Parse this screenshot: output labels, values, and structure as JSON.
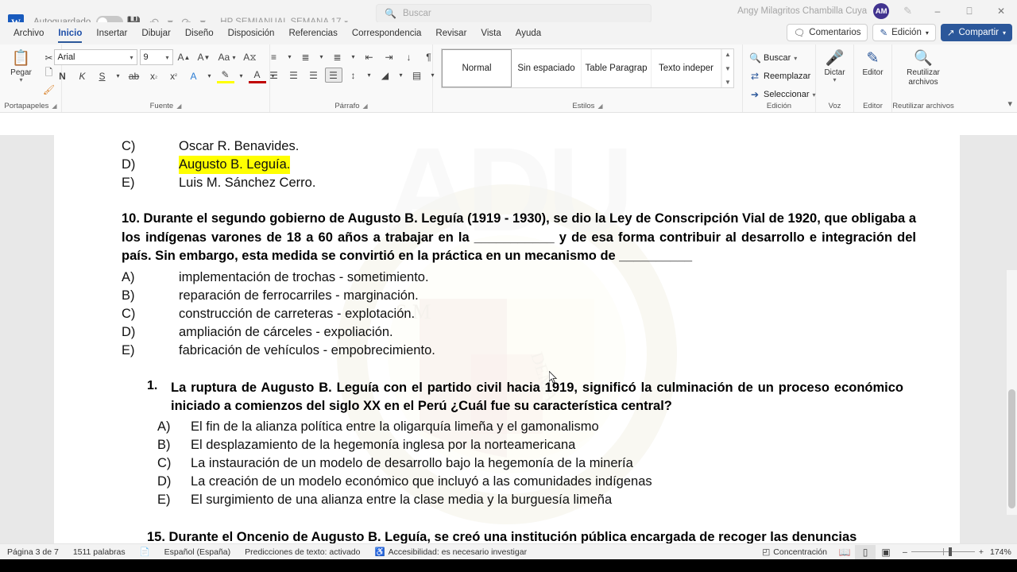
{
  "titlebar": {
    "autosave_label": "Autoguardado",
    "autosave_state": "off",
    "document_title": "HP SEMIANUAL SEMANA 17",
    "user_name": "Angy Milagritos Chambilla Cuya",
    "user_initials": "AM"
  },
  "search": {
    "placeholder": "Buscar"
  },
  "tabs": [
    {
      "label": "Archivo",
      "active": false
    },
    {
      "label": "Inicio",
      "active": true
    },
    {
      "label": "Insertar",
      "active": false
    },
    {
      "label": "Dibujar",
      "active": false
    },
    {
      "label": "Diseño",
      "active": false
    },
    {
      "label": "Disposición",
      "active": false
    },
    {
      "label": "Referencias",
      "active": false
    },
    {
      "label": "Correspondencia",
      "active": false
    },
    {
      "label": "Revisar",
      "active": false
    },
    {
      "label": "Vista",
      "active": false
    },
    {
      "label": "Ayuda",
      "active": false
    }
  ],
  "tab_actions": {
    "comments": "Comentarios",
    "editing": "Edición",
    "share": "Compartir"
  },
  "ribbon": {
    "clipboard": {
      "group": "Portapapeles",
      "paste": "Pegar"
    },
    "font": {
      "group": "Fuente",
      "font_name": "Arial",
      "font_size": "9",
      "bold": "N",
      "italic": "K",
      "underline": "S"
    },
    "paragraph": {
      "group": "Párrafo"
    },
    "styles": {
      "group": "Estilos",
      "items": [
        "Normal",
        "Sin espaciado",
        "Table Paragrap",
        "Texto indeper"
      ],
      "selected": "Normal"
    },
    "editing": {
      "group": "Edición",
      "find": "Buscar",
      "replace": "Reemplazar",
      "select": "Seleccionar"
    },
    "voice": {
      "group": "Voz",
      "dictate": "Dictar"
    },
    "editor": {
      "group": "Editor",
      "editor": "Editor"
    },
    "reuse": {
      "group": "Reutilizar archivos",
      "label_line1": "Reutilizar",
      "label_line2": "archivos"
    }
  },
  "document": {
    "watermark_text": "ADU",
    "prev_options": [
      {
        "key": "C)",
        "text": "Oscar R. Benavides.",
        "highlight": false
      },
      {
        "key": "D)",
        "text": "Augusto B. Leguía.",
        "highlight": true
      },
      {
        "key": "E)",
        "text": "Luis M. Sánchez Cerro.",
        "highlight": false
      }
    ],
    "question10": {
      "text": "10. Durante el segundo gobierno de Augusto B. Leguía (1919 - 1930), se dio la Ley de Conscripción Vial de 1920, que obligaba a los indígenas varones de 18 a 60 años a trabajar en la ___________ y de esa forma contribuir al desarrollo e integración del país. Sin embargo, esta medida se convirtió en la práctica en un mecanismo de __________",
      "options": [
        {
          "key": "A)",
          "text": "implementación de trochas - sometimiento."
        },
        {
          "key": "B)",
          "text": "reparación de ferrocarriles - marginación."
        },
        {
          "key": "C)",
          "text": "construcción de carreteras - explotación."
        },
        {
          "key": "D)",
          "text": "ampliación de cárceles - expoliación."
        },
        {
          "key": "E)",
          "text": "fabricación de vehículos -  empobrecimiento."
        }
      ]
    },
    "question1": {
      "number": "1.",
      "text": "La ruptura de Augusto B. Leguía con el partido civil hacia 1919, significó la culminación de un proceso económico iniciado a comienzos del siglo XX en el Perú ¿Cuál fue su característica central?",
      "options": [
        {
          "key": "A)",
          "text": "El fin de la alianza política entre la oligarquía limeña y el gamonalismo"
        },
        {
          "key": "B)",
          "text": "El desplazamiento de la hegemonía inglesa por la norteamericana"
        },
        {
          "key": "C)",
          "text": "La instauración de un modelo de desarrollo bajo la hegemonía de la minería"
        },
        {
          "key": "D)",
          "text": "La creación de un modelo económico que incluyó a las comunidades indígenas"
        },
        {
          "key": "E)",
          "text": "El surgimiento de una alianza entre la clase media y la burguesía limeña"
        }
      ]
    },
    "question15": {
      "text": "15. Durante el Oncenio de Augusto B. Leguía, se creó una institución pública encargada de recoger las denuncias"
    }
  },
  "statusbar": {
    "page": "Página 3 de 7",
    "words": "1511 palabras",
    "language": "Español (España)",
    "predictions": "Predicciones de texto: activado",
    "accessibility": "Accesibilidad: es necesario investigar",
    "focus": "Concentración",
    "zoom": "174%"
  },
  "colors": {
    "accent": "#2b579a",
    "highlight": "#ffff00",
    "avatar": "#41338f"
  }
}
